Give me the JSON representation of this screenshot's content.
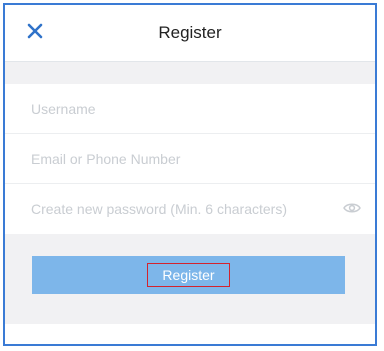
{
  "header": {
    "title": "Register",
    "close_icon": "close-icon"
  },
  "form": {
    "username_placeholder": "Username",
    "email_placeholder": "Email or Phone Number",
    "password_placeholder": "Create new password (Min. 6 characters)",
    "password_toggle_icon": "eye-icon"
  },
  "actions": {
    "register_label": "Register"
  },
  "colors": {
    "accent": "#2f72c9",
    "button": "#7db6ea",
    "frame": "#3a7bd5",
    "highlight": "#d3232e",
    "band": "#f1f1f3"
  }
}
